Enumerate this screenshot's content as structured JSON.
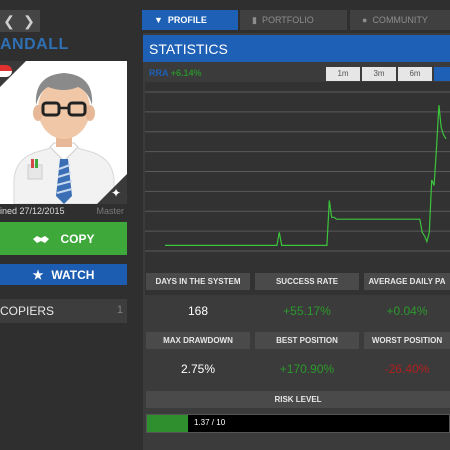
{
  "nav": {
    "prev_icon": "chevron-left-icon",
    "next_icon": "chevron-right-icon"
  },
  "trader": {
    "name": "ANDALL",
    "joined": "ined 27/12/2015",
    "level": "Master",
    "copy_label": "COPY",
    "watch_label": "WATCH",
    "copiers_label": "COPIERS",
    "copiers_count": "1"
  },
  "tabs": {
    "profile": "PROFILE",
    "portfolio": "PORTFOLIO",
    "community": "COMMUNITY"
  },
  "statistics": {
    "title": "STATISTICS",
    "legend_prefix": "RRA",
    "legend_value": "+6.14%",
    "ranges": [
      "1m",
      "3m",
      "6m",
      ""
    ],
    "active_range": 3
  },
  "stats": [
    {
      "label": "DAYS IN THE SYSTEM",
      "value": "168",
      "color": "#ffffff"
    },
    {
      "label": "SUCCESS RATE",
      "value": "+55.17%",
      "color": "#2c9a2c"
    },
    {
      "label": "AVERAGE DAILY PA",
      "value": "+0.04%",
      "color": "#2c9a2c"
    },
    {
      "label": "MAX DRAWDOWN",
      "value": "2.75%",
      "color": "#ffffff"
    },
    {
      "label": "BEST POSITION",
      "value": "+170.90%",
      "color": "#2c9a2c"
    },
    {
      "label": "WORST POSITION",
      "value": "-26.40%",
      "color": "#b02020"
    }
  ],
  "risk": {
    "label": "RISK LEVEL",
    "text": "1.37 / 10",
    "fraction": 0.137
  },
  "colors": {
    "accent": "#1e60b5",
    "copy_green": "#3ea93a",
    "positive": "#2c9a2c",
    "negative": "#b02020",
    "line": "#3cc43c"
  },
  "chart_data": {
    "type": "line",
    "series": [
      {
        "values": [
          0.3,
          0.3,
          0.3,
          0.3,
          0.3,
          0.3,
          0.3,
          0.3,
          0.3,
          0.3,
          0.3,
          0.3,
          0.3,
          0.3,
          0.3,
          0.3,
          0.3,
          0.3,
          0.3,
          0.3,
          0.3,
          0.3,
          0.3,
          0.3,
          0.3,
          0.3,
          0.3,
          0.3,
          0.3,
          0.3,
          0.3,
          0.3,
          0.3,
          0.3,
          0.3,
          0.3,
          0.3,
          0.3,
          0.3,
          0.3,
          0.3,
          0.3,
          0.3,
          0.3,
          0.3,
          0.3,
          0.3,
          0.3,
          1.0,
          0.3,
          0.3,
          0.3,
          0.3,
          0.3,
          0.3,
          0.3,
          0.3,
          0.3,
          0.3,
          0.3,
          0.3,
          0.3,
          0.3,
          0.3,
          0.3,
          0.3,
          0.3,
          0.3,
          0.3,
          2.7,
          1.8,
          1.8,
          1.7,
          1.7,
          1.7,
          1.7,
          1.7,
          1.7,
          1.7,
          1.7,
          1.7,
          1.7,
          1.7,
          1.7,
          1.7,
          1.7,
          1.7,
          1.7,
          1.7,
          1.7,
          1.7,
          1.7,
          1.7,
          1.7,
          1.7,
          1.7,
          1.7,
          1.7,
          1.7,
          1.7,
          1.7,
          1.7,
          1.7,
          1.7,
          1.7,
          1.7,
          1.7,
          1.7,
          1.0,
          0.8,
          0.5,
          1.0,
          3.8,
          3.5,
          5.5,
          7.8,
          6.6,
          6.2,
          6.0
        ]
      }
    ],
    "ylim": [
      0,
      8.5
    ],
    "grid": true
  }
}
